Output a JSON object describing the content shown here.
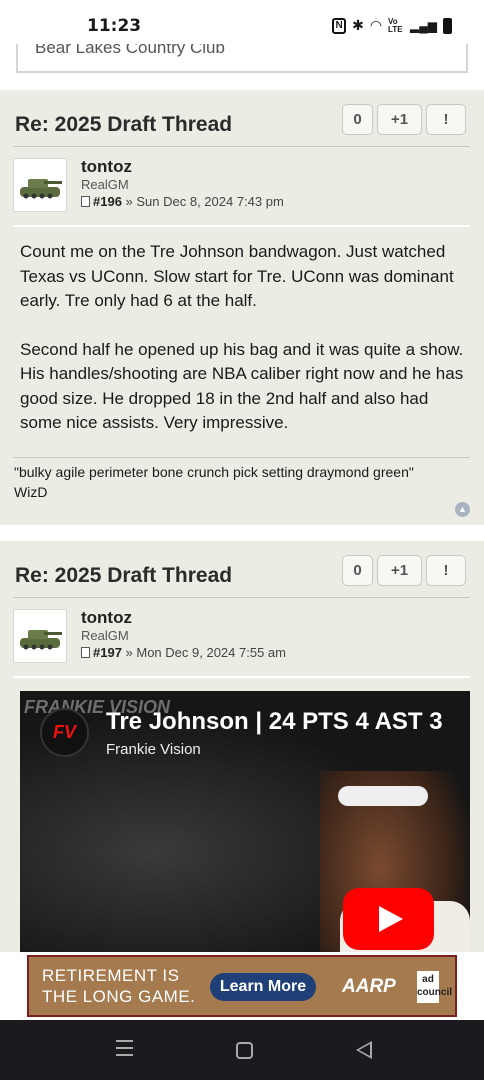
{
  "status_bar": {
    "time": "11:23",
    "icons": [
      "nfc-icon",
      "bluetooth-icon",
      "wifi-icon",
      "volte-icon",
      "signal-icon",
      "battery-icon"
    ],
    "volte_label": "Vo LTE"
  },
  "previous_box": {
    "text": "Bear Lakes Country Club"
  },
  "posts": [
    {
      "title": "Re: 2025 Draft Thread",
      "votes": {
        "count": "0",
        "plus_one": "+1",
        "report": "!"
      },
      "author": "tontoz",
      "rank": "RealGM",
      "post_number": "#196",
      "date": " » Sun Dec 8, 2024 7:43 pm",
      "paragraphs": [
        "Count me on the Tre Johnson bandwagon. Just watched Texas vs UConn. Slow start for Tre. UConn was dominant early. Tre only had 6 at the half.",
        "Second half he opened up his bag and it was quite a show. His handles/shooting are NBA caliber right now and he has good size. He dropped 18 in the 2nd half and also had some nice assists. Very impressive."
      ],
      "signature": "\"bulky agile perimeter bone crunch pick setting draymond green\"",
      "signature_author": "WizD"
    },
    {
      "title": "Re: 2025 Draft Thread",
      "votes": {
        "count": "0",
        "plus_one": "+1",
        "report": "!"
      },
      "author": "tontoz",
      "rank": "RealGM",
      "post_number": "#197",
      "date": " » Mon Dec 9, 2024 7:55 am",
      "video": {
        "title": "Tre Johnson | 24 PTS 4 AST 3",
        "channel": "Frankie Vision",
        "logo_text": "FV",
        "watermark": "FRANKIE VISION"
      }
    }
  ],
  "ad": {
    "headline_line1": "RETIREMENT IS",
    "headline_line2": "THE LONG GAME.",
    "button": "Learn More",
    "brand": "AARP",
    "choice_label": "ad council",
    "background_color": "#a57a4e"
  },
  "nav_bar": {
    "icons": [
      "recent-apps-icon",
      "home-icon",
      "back-icon"
    ]
  }
}
